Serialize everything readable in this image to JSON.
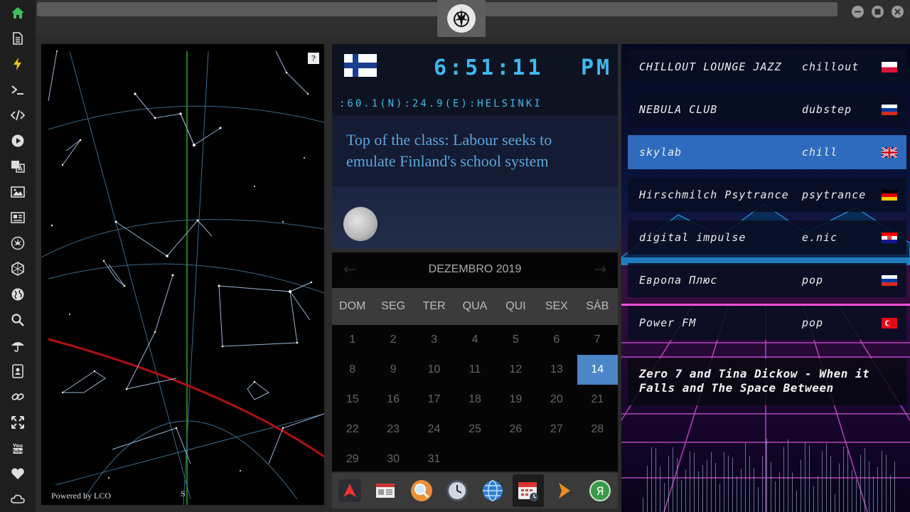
{
  "sidebar": {
    "items": [
      {
        "icon": "home-icon",
        "color": "#3fbf5f"
      },
      {
        "icon": "document-icon"
      },
      {
        "icon": "lightning-icon",
        "color": "#f1c40f"
      },
      {
        "icon": "terminal-icon"
      },
      {
        "icon": "code-icon"
      },
      {
        "icon": "play-icon"
      },
      {
        "icon": "translate-icon"
      },
      {
        "icon": "image-icon"
      },
      {
        "icon": "newspaper-icon"
      },
      {
        "icon": "rebel-alliance-icon"
      },
      {
        "icon": "hexagon-icon"
      },
      {
        "icon": "globe-icon"
      },
      {
        "icon": "search-icon"
      },
      {
        "icon": "umbrella-icon"
      },
      {
        "icon": "contact-card-icon"
      },
      {
        "icon": "link-icon"
      },
      {
        "icon": "expand-icon"
      },
      {
        "icon": "youtube-icon"
      },
      {
        "icon": "heart-icon"
      },
      {
        "icon": "cloud-icon"
      }
    ]
  },
  "header": {
    "logo_icon": "rebel-alliance-icon"
  },
  "skymap": {
    "help": "?",
    "powered_by": "Powered by LCO",
    "south_label": "S"
  },
  "clock": {
    "time": "6:51:11",
    "ampm": "PM",
    "coords": ":60.1(N):24.9(E):HELSINKI",
    "flag": "finland-flag-icon"
  },
  "news": {
    "headline": "Top of the class: Labour seeks to emulate Finland's school system"
  },
  "moon": {
    "icon": "moon-phase-icon"
  },
  "calendar": {
    "month": "DEZEMBRO 2019",
    "prev": "←",
    "next": "→",
    "weekdays": [
      "DOM",
      "SEG",
      "TER",
      "QUA",
      "QUI",
      "SEX",
      "SÁB"
    ],
    "weeks": [
      [
        "1",
        "2",
        "3",
        "4",
        "5",
        "6",
        "7"
      ],
      [
        "8",
        "9",
        "10",
        "11",
        "12",
        "13",
        "14"
      ],
      [
        "15",
        "16",
        "17",
        "18",
        "19",
        "20",
        "21"
      ],
      [
        "22",
        "23",
        "24",
        "25",
        "26",
        "27",
        "28"
      ],
      [
        "29",
        "30",
        "31",
        "",
        "",
        "",
        ""
      ]
    ],
    "selected": "14"
  },
  "dock": {
    "items": [
      {
        "icon": "arch-app-icon"
      },
      {
        "icon": "news-reader-icon"
      },
      {
        "icon": "search-app-icon"
      },
      {
        "icon": "clock-app-icon"
      },
      {
        "icon": "globe-app-icon"
      },
      {
        "icon": "calendar-app-icon",
        "active": true
      },
      {
        "icon": "play-arrow-app-icon"
      },
      {
        "icon": "yandex-app-icon"
      }
    ]
  },
  "radio": {
    "stations": [
      {
        "name": "CHILLOUT LOUNGE JAZZ",
        "genre": "chillout",
        "flag": "poland"
      },
      {
        "name": "NEBULA CLUB",
        "genre": "dubstep",
        "flag": "russia"
      },
      {
        "name": "skylab",
        "genre": "chill",
        "flag": "uk",
        "active": true
      },
      {
        "name": "Hirschmilch Psytrance",
        "genre": "psytrance",
        "flag": "germany"
      },
      {
        "name": "digital impulse",
        "genre": "e.nic",
        "flag": "croatia"
      },
      {
        "name": "Европа Плюс",
        "genre": "pop",
        "flag": "russia"
      },
      {
        "name": "Power FM",
        "genre": "pop",
        "flag": "turkey"
      }
    ],
    "now_playing": "Zero 7 and Tina Dickow - When it Falls and The Space Between"
  }
}
